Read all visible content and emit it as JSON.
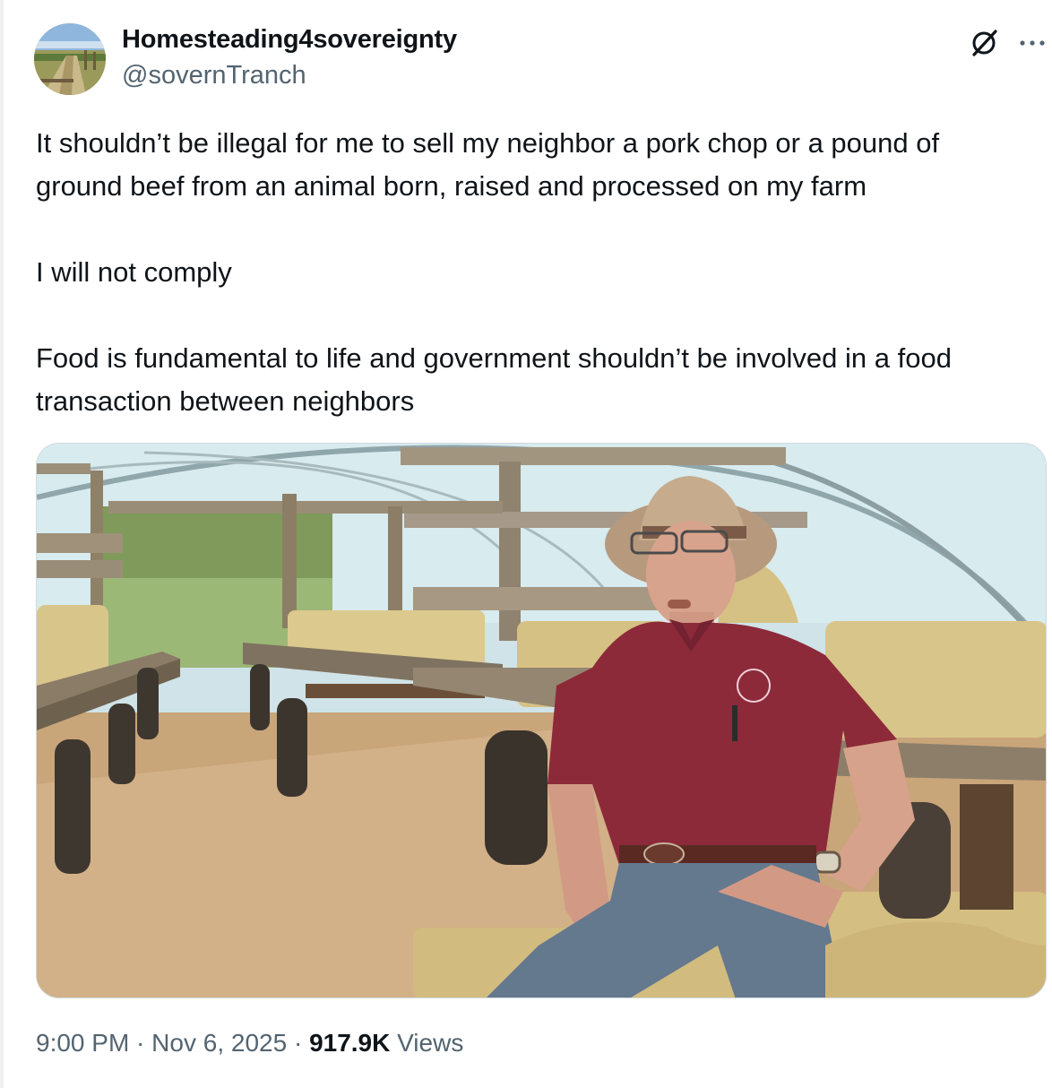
{
  "tweet": {
    "author": {
      "display_name": "Homesteading4sovereignty",
      "handle": "@sovernTranch"
    },
    "header_icons": {
      "grok": "grok-icon",
      "more": "more-icon"
    },
    "text": {
      "paragraph_1": "It shouldn’t be illegal for me to sell my neighbor a pork chop or a pound of ground beef from an animal born, raised and processed on my farm",
      "paragraph_2": "I will not comply",
      "paragraph_3": "Food is fundamental to life and government shouldn’t be involved in a food transaction between neighbors"
    },
    "meta": {
      "time": "9:00 PM",
      "separator": " · ",
      "date": "Nov 6, 2025",
      "views_count": "917.9K",
      "views_label": " Views"
    },
    "colors": {
      "text_primary": "#0f1419",
      "text_secondary": "#536471",
      "border": "#cfd9de",
      "shirt": "#8c2a3a",
      "hay": "#d8c58a"
    }
  }
}
